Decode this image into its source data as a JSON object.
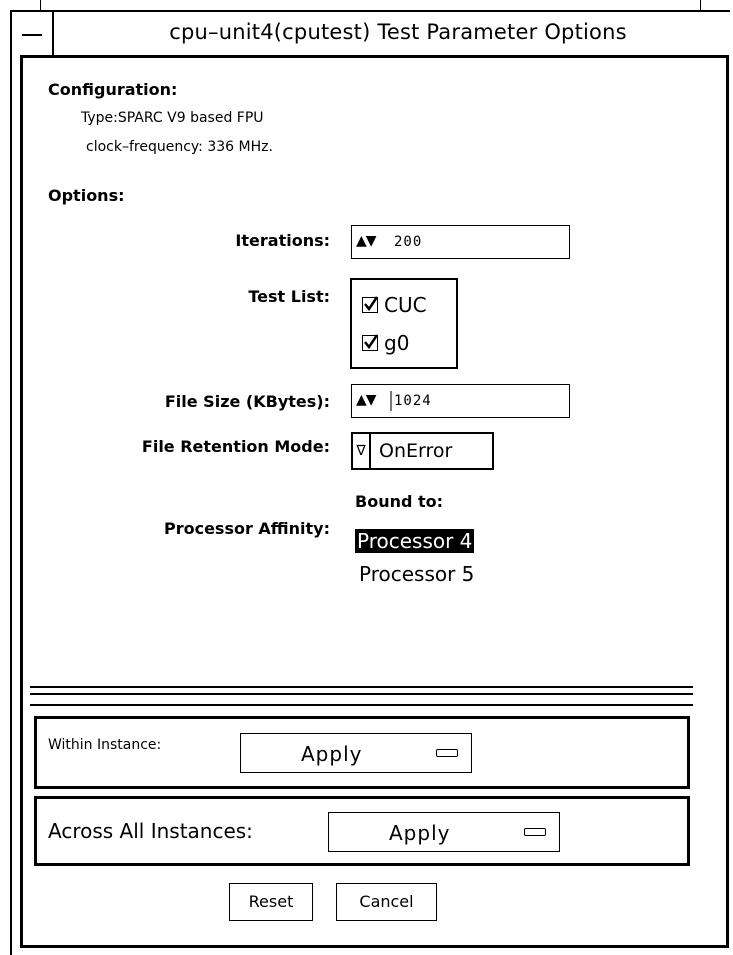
{
  "window": {
    "title": "cpu–unit4(cputest) Test Parameter Options"
  },
  "configuration": {
    "heading": "Configuration:",
    "type_line": "Type:SPARC V9 based FPU",
    "clock_line": "clock–frequency: 336 MHz."
  },
  "options": {
    "heading": "Options:",
    "iterations": {
      "label": "Iterations:",
      "value": "200",
      "icon": "spin-arrows-icon"
    },
    "test_list": {
      "label": "Test List:",
      "items": [
        {
          "label": "CUC",
          "checked": true
        },
        {
          "label": "g0",
          "checked": true
        }
      ]
    },
    "file_size": {
      "label": "File Size (KBytes):",
      "value": "1024",
      "icon": "spin-arrows-icon"
    },
    "file_retention": {
      "label": "File Retention Mode:",
      "value": "OnError",
      "icon": "triangle-down-icon"
    },
    "processor_affinity": {
      "label": "Processor Affinity:",
      "bound_label": "Bound to:",
      "processors": [
        {
          "label": "Processor 4",
          "selected": true
        },
        {
          "label": "Processor 5",
          "selected": false
        }
      ]
    }
  },
  "apply": {
    "within": {
      "label": "Within Instance:",
      "button": "Apply"
    },
    "across": {
      "label": "Across All Instances:",
      "button": "Apply"
    }
  },
  "buttons": {
    "reset": "Reset",
    "cancel": "Cancel"
  },
  "colors": {
    "foreground": "#000000",
    "background": "#ffffff",
    "selection_bg": "#000000",
    "selection_fg": "#ffffff"
  }
}
